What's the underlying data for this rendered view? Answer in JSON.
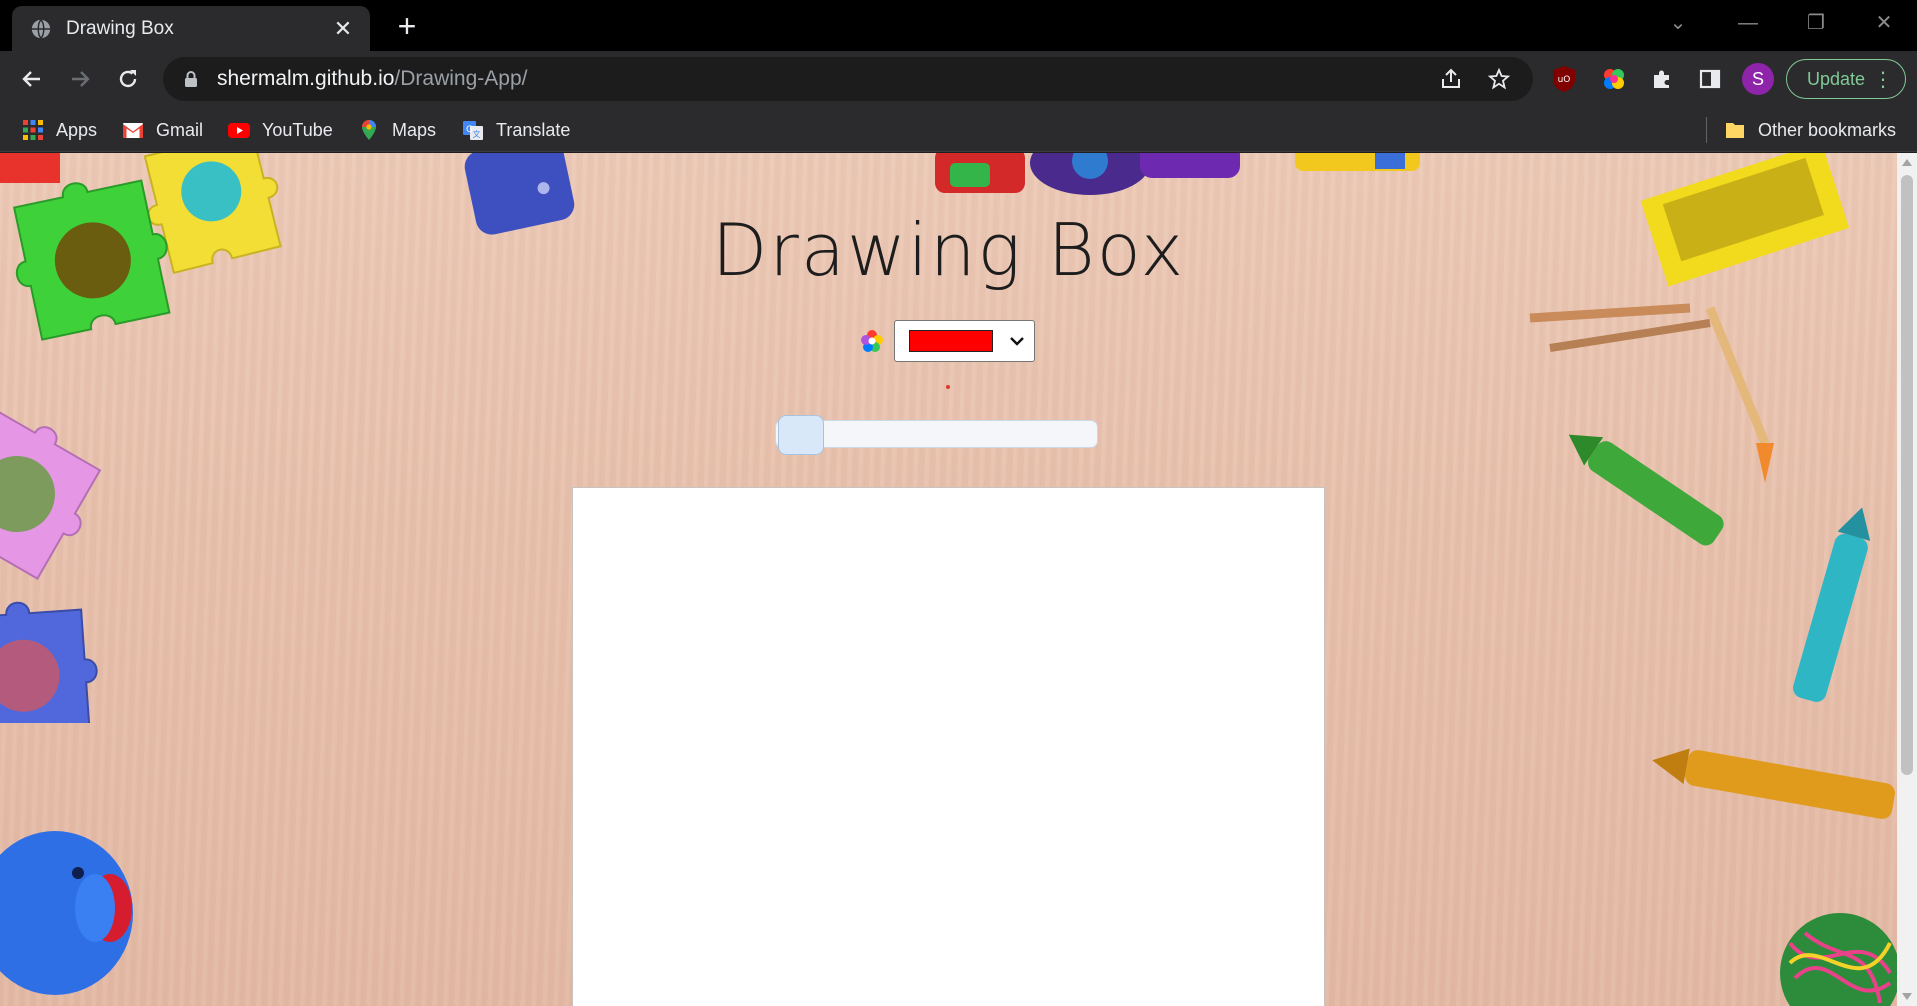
{
  "browser": {
    "tab": {
      "title": "Drawing Box"
    },
    "url": {
      "host": "shermalm.github.io",
      "path": "/Drawing-App/"
    },
    "profile_initial": "S",
    "update_label": "Update",
    "bookmarks": [
      {
        "label": "Apps",
        "icon": "apps-grid-icon"
      },
      {
        "label": "Gmail",
        "icon": "gmail-icon"
      },
      {
        "label": "YouTube",
        "icon": "youtube-icon"
      },
      {
        "label": "Maps",
        "icon": "maps-pin-icon"
      },
      {
        "label": "Translate",
        "icon": "translate-icon"
      }
    ],
    "other_bookmarks": "Other bookmarks"
  },
  "page": {
    "title": "Drawing Box",
    "color_picker": {
      "selected_color": "#ff0000"
    }
  },
  "colors": {
    "brand_green": "#81c995",
    "profile_purple": "#8e24aa",
    "selected_swatch": "#ff0000"
  }
}
